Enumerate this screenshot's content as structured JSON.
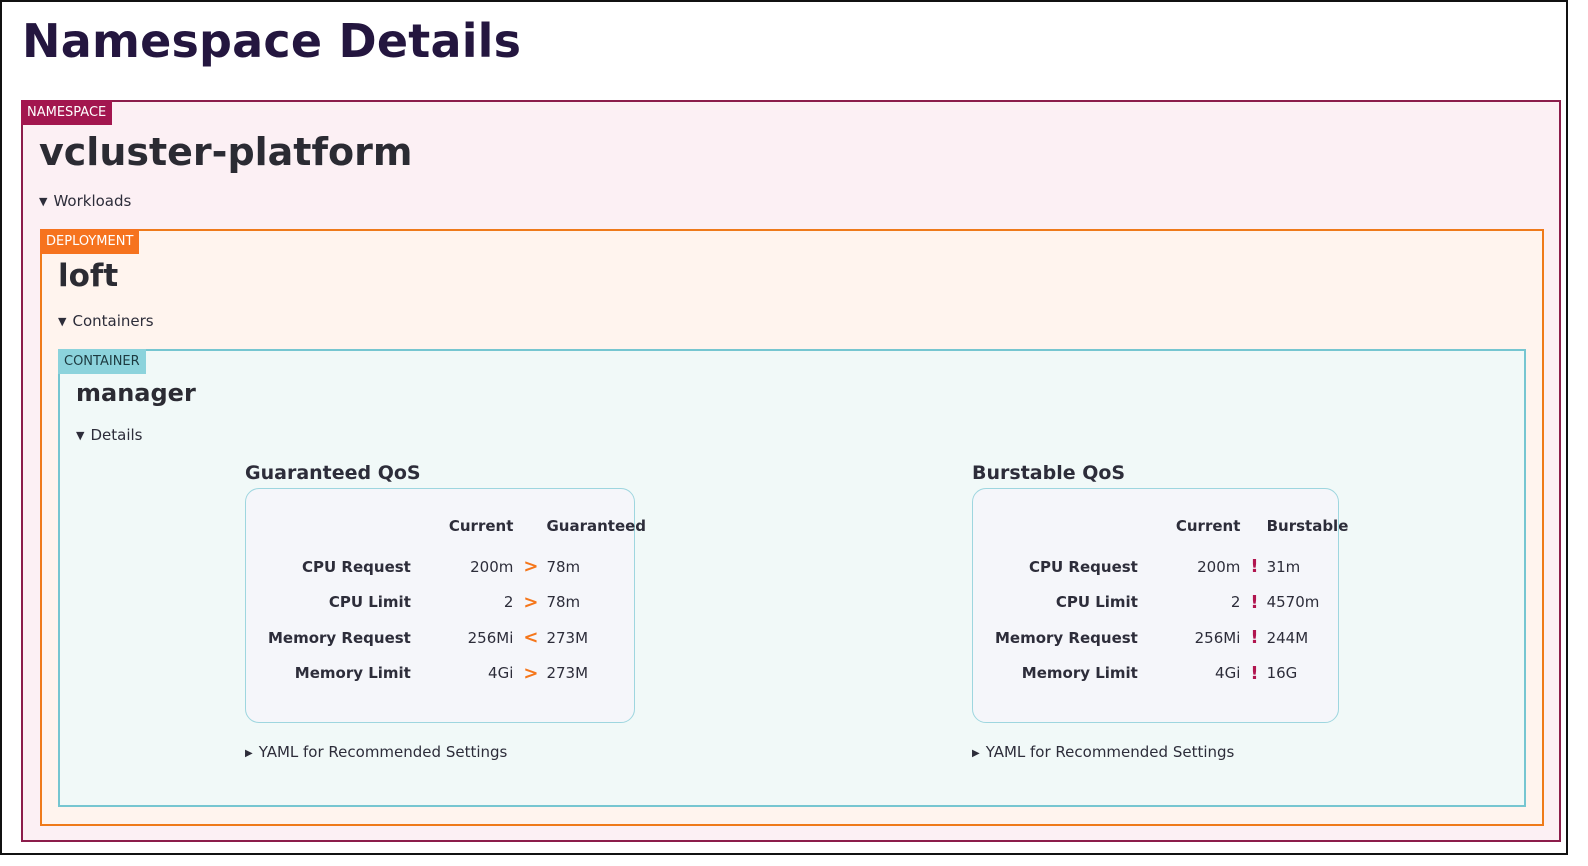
{
  "page_title": "Namespace Details",
  "namespace": {
    "tag": "NAMESPACE",
    "name": "vcluster-platform",
    "workloads_label": "Workloads",
    "deployment": {
      "tag": "DEPLOYMENT",
      "name": "loft",
      "containers_label": "Containers",
      "container": {
        "tag": "CONTAINER",
        "name": "manager",
        "details_label": "Details",
        "guaranteed": {
          "title": "Guaranteed QoS",
          "col_current": "Current",
          "col_target": "Guaranteed",
          "rows": [
            {
              "label": "CPU Request",
              "current": "200m",
              "indicator": ">",
              "recommended": "78m"
            },
            {
              "label": "CPU Limit",
              "current": "2",
              "indicator": ">",
              "recommended": "78m"
            },
            {
              "label": "Memory Request",
              "current": "256Mi",
              "indicator": "<",
              "recommended": "273M"
            },
            {
              "label": "Memory Limit",
              "current": "4Gi",
              "indicator": ">",
              "recommended": "273M"
            }
          ],
          "yaml_label": "YAML for Recommended Settings"
        },
        "burstable": {
          "title": "Burstable QoS",
          "col_current": "Current",
          "col_target": "Burstable",
          "rows": [
            {
              "label": "CPU Request",
              "current": "200m",
              "indicator": "!",
              "recommended": "31m"
            },
            {
              "label": "CPU Limit",
              "current": "2",
              "indicator": "!",
              "recommended": "4570m"
            },
            {
              "label": "Memory Request",
              "current": "256Mi",
              "indicator": "!",
              "recommended": "244M"
            },
            {
              "label": "Memory Limit",
              "current": "4Gi",
              "indicator": "!",
              "recommended": "16G"
            }
          ],
          "yaml_label": "YAML for Recommended Settings"
        }
      }
    }
  },
  "colors": {
    "namespace": "#a3164f",
    "deployment": "#f6731e",
    "container": "#8cd3dc",
    "arrow_indicator": "#f5761a",
    "warning_indicator": "#b1154f"
  }
}
